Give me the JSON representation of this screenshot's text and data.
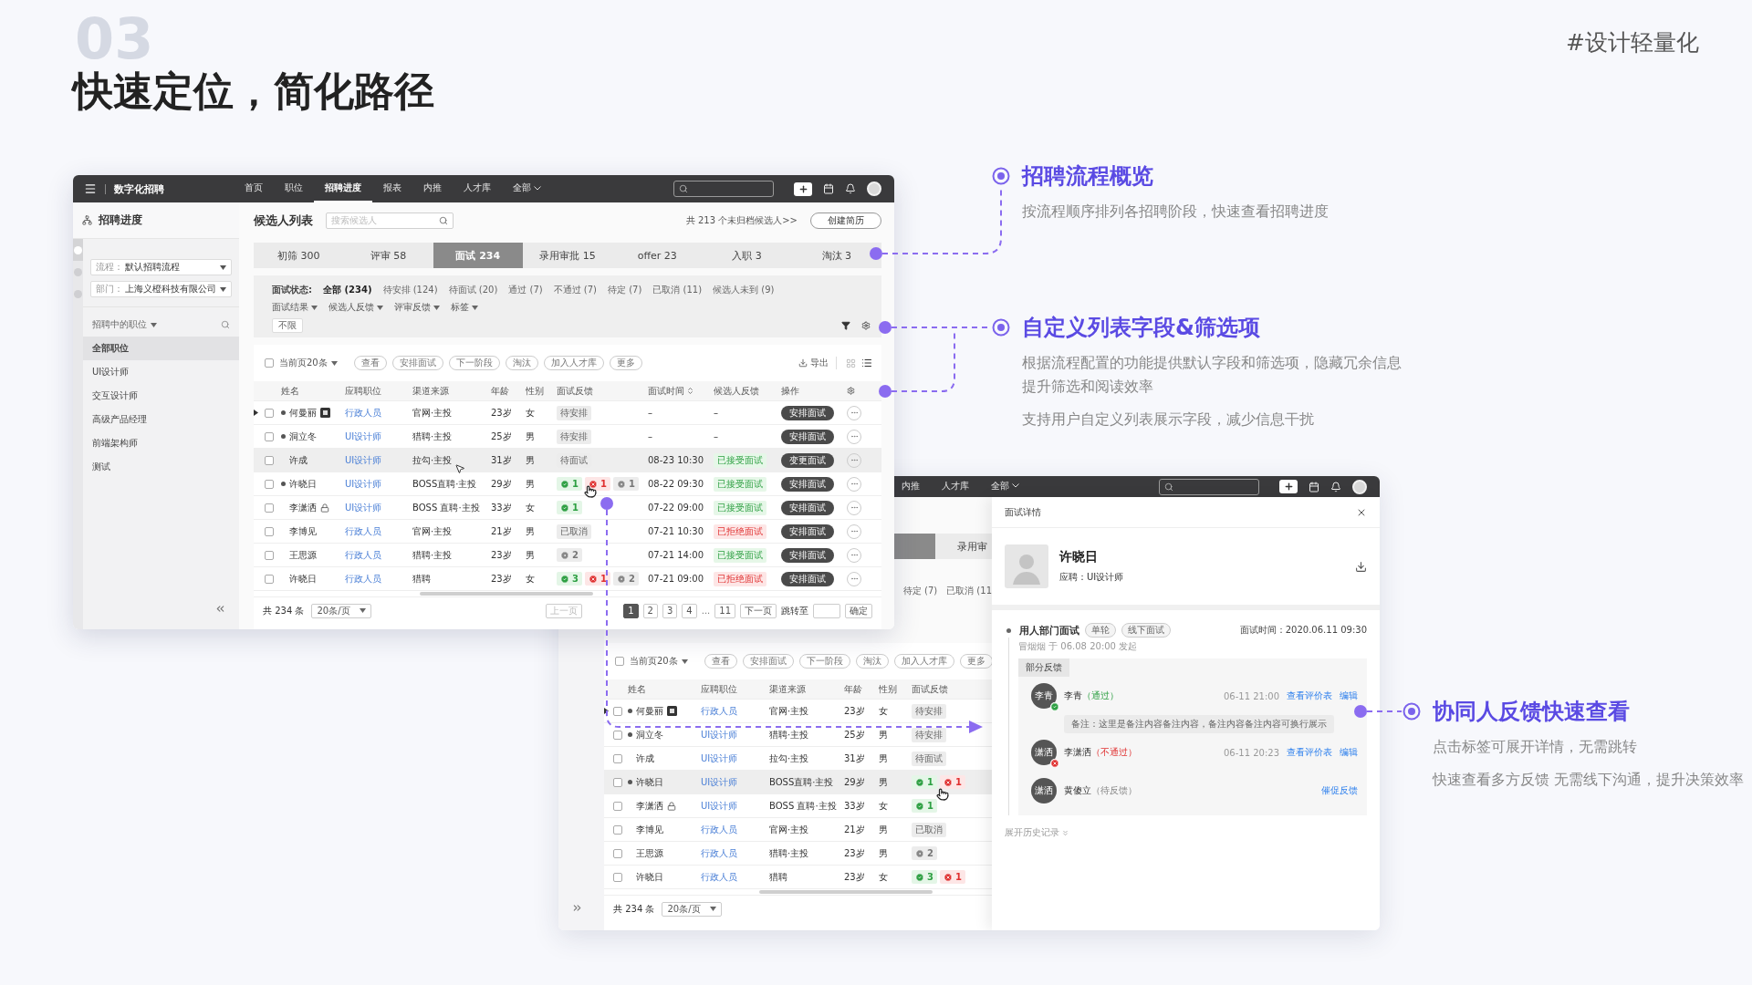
{
  "page": {
    "number": "03",
    "title": "快速定位，简化路径",
    "hashtag": "#设计轻量化"
  },
  "main_window": {
    "app_name": "数字化招聘",
    "nav": [
      {
        "label": "首页",
        "selected": false,
        "dropdown": false
      },
      {
        "label": "职位",
        "selected": false,
        "dropdown": false
      },
      {
        "label": "招聘进度",
        "selected": true,
        "dropdown": false
      },
      {
        "label": "报表",
        "selected": false,
        "dropdown": false
      },
      {
        "label": "内推",
        "selected": false,
        "dropdown": false
      },
      {
        "label": "人才库",
        "selected": false,
        "dropdown": false
      },
      {
        "label": "全部",
        "selected": false,
        "dropdown": true
      }
    ],
    "sidebar": {
      "title": "招聘进度",
      "rail": [
        {
          "selected": true
        },
        {
          "selected": false
        },
        {
          "selected": false
        }
      ],
      "selects": [
        {
          "label": "流程：",
          "value": "默认招聘流程"
        },
        {
          "label": "部门：",
          "value": "上海义橙科技有限公司"
        }
      ],
      "section": "招聘中的职位",
      "items": [
        {
          "label": "全部职位",
          "selected": true
        },
        {
          "label": "UI设计师",
          "selected": false
        },
        {
          "label": "交互设计师",
          "selected": false
        },
        {
          "label": "高级产品经理",
          "selected": false
        },
        {
          "label": "前端架构师",
          "selected": false
        },
        {
          "label": "测试",
          "selected": false
        }
      ]
    },
    "header": {
      "title": "候选人列表",
      "search_placeholder": "搜索候选人",
      "summary": "共 213 个未归档候选人>>",
      "create_button": "创建简历"
    },
    "stages": [
      {
        "label": "初筛",
        "count": "300",
        "selected": false
      },
      {
        "label": "评审",
        "count": "58",
        "selected": false
      },
      {
        "label": "面试",
        "count": "234",
        "selected": true
      },
      {
        "label": "录用审批",
        "count": "15",
        "selected": false
      },
      {
        "label": "offer",
        "count": "23",
        "selected": false
      },
      {
        "label": "入职",
        "count": "3",
        "selected": false
      },
      {
        "label": "淘汰",
        "count": "3",
        "selected": false
      }
    ],
    "filters": {
      "status_label": "面试状态:",
      "statuses": [
        {
          "label": "全部 (234)",
          "selected": true
        },
        {
          "label": "待安排 (124)",
          "selected": false
        },
        {
          "label": "待面试 (20)",
          "selected": false
        },
        {
          "label": "通过 (7)",
          "selected": false
        },
        {
          "label": "不通过 (7)",
          "selected": false
        },
        {
          "label": "待定 (7)",
          "selected": false
        },
        {
          "label": "已取消 (11)",
          "selected": false
        },
        {
          "label": "候选人未到 (9)",
          "selected": false
        }
      ],
      "dropdowns": [
        "面试结果",
        "候选人反馈",
        "评审反馈",
        "标签"
      ],
      "tag": "不限"
    },
    "toolbar": {
      "checked": false,
      "page_select": "当前页20条",
      "actions": [
        "查看",
        "安排面试",
        "下一阶段",
        "淘汰",
        "加入人才库",
        "更多"
      ],
      "export": "导出"
    },
    "columns": [
      {
        "label": "姓名",
        "sortable": false
      },
      {
        "label": "应聘职位",
        "sortable": false
      },
      {
        "label": "渠道来源",
        "sortable": false
      },
      {
        "label": "年龄",
        "sortable": false
      },
      {
        "label": "性别",
        "sortable": false
      },
      {
        "label": "面试反馈",
        "sortable": false
      },
      {
        "label": "面试时间",
        "sortable": true
      },
      {
        "label": "候选人反馈",
        "sortable": false
      },
      {
        "label": "操作",
        "sortable": false
      }
    ],
    "rows": [
      {
        "name": "何曼丽",
        "dot": true,
        "expandable": true,
        "flag": {
          "kind": "badge"
        },
        "checked": false,
        "highlighted": false,
        "position": "行政人员",
        "source": "官网·主投",
        "age": "23岁",
        "gender": "女",
        "feedback": {
          "kind": "tag",
          "text": "待安排"
        },
        "time": "–",
        "candidate": {
          "kind": "none",
          "text": "–"
        },
        "action": "安排面试"
      },
      {
        "name": "洞立冬",
        "dot": true,
        "expandable": false,
        "checked": false,
        "highlighted": false,
        "position": "UI设计师",
        "source": "猎聘·主投",
        "age": "25岁",
        "gender": "男",
        "feedback": {
          "kind": "tag",
          "text": "待安排"
        },
        "time": "–",
        "candidate": {
          "kind": "none",
          "text": "–"
        },
        "action": "安排面试"
      },
      {
        "name": "许成",
        "dot": false,
        "expandable": false,
        "checked": false,
        "highlighted": true,
        "position": "UI设计师",
        "source": "拉勾·主投",
        "age": "31岁",
        "gender": "男",
        "feedback": {
          "kind": "tag",
          "text": "待面试"
        },
        "time": "08-23 10:30",
        "candidate": {
          "kind": "accepted",
          "text": "已接受面试"
        },
        "action": "变更面试"
      },
      {
        "name": "许晓日",
        "dot": true,
        "expandable": false,
        "checked": false,
        "highlighted": false,
        "position": "UI设计师",
        "source": "BOSS直聘·主投",
        "age": "29岁",
        "gender": "男",
        "feedback": {
          "kind": "counts",
          "counts": [
            {
              "kind": "pass",
              "text": "1"
            },
            {
              "kind": "fail",
              "text": "1"
            },
            {
              "kind": "pending",
              "text": "1"
            }
          ]
        },
        "time": "08-22 09:30",
        "candidate": {
          "kind": "accepted",
          "text": "已接受面试"
        },
        "action": "安排面试"
      },
      {
        "name": "李潇洒",
        "dot": false,
        "expandable": false,
        "flag": {
          "kind": "lock"
        },
        "checked": false,
        "highlighted": false,
        "position": "UI设计师",
        "source": "BOSS 直聘·主投",
        "age": "33岁",
        "gender": "女",
        "feedback": {
          "kind": "counts",
          "counts": [
            {
              "kind": "pass",
              "text": "1"
            }
          ]
        },
        "time": "07-22 09:00",
        "candidate": {
          "kind": "accepted",
          "text": "已接受面试"
        },
        "action": "安排面试"
      },
      {
        "name": "李博见",
        "dot": false,
        "expandable": false,
        "checked": false,
        "highlighted": false,
        "position": "行政人员",
        "source": "官网·主投",
        "age": "21岁",
        "gender": "男",
        "feedback": {
          "kind": "tag",
          "text": "已取消"
        },
        "time": "07-21 10:30",
        "candidate": {
          "kind": "rejected",
          "text": "已拒绝面试"
        },
        "action": "安排面试"
      },
      {
        "name": "王思源",
        "dot": false,
        "expandable": false,
        "checked": false,
        "highlighted": false,
        "position": "行政人员",
        "source": "猎聘·主投",
        "age": "23岁",
        "gender": "男",
        "feedback": {
          "kind": "counts",
          "counts": [
            {
              "kind": "pending",
              "text": "2"
            }
          ]
        },
        "time": "07-21 14:00",
        "candidate": {
          "kind": "accepted",
          "text": "已接受面试"
        },
        "action": "安排面试"
      },
      {
        "name": "许晓日",
        "dot": false,
        "expandable": false,
        "checked": false,
        "highlighted": false,
        "position": "行政人员",
        "source": "猎聘",
        "age": "23岁",
        "gender": "女",
        "feedback": {
          "kind": "counts",
          "counts": [
            {
              "kind": "pass",
              "text": "3"
            },
            {
              "kind": "fail",
              "text": "1"
            },
            {
              "kind": "pending",
              "text": "2"
            }
          ]
        },
        "time": "07-21 09:00",
        "candidate": {
          "kind": "rejected",
          "text": "已拒绝面试"
        },
        "action": "安排面试"
      }
    ],
    "footer": {
      "total": "共 234 条",
      "page_size": "20条/页",
      "prev": "上一页",
      "pages": [
        {
          "label": "1",
          "selected": true,
          "kind": "page"
        },
        {
          "label": "2",
          "selected": false,
          "kind": "page"
        },
        {
          "label": "3",
          "selected": false,
          "kind": "page"
        },
        {
          "label": "4",
          "selected": false,
          "kind": "page"
        },
        {
          "label": "...",
          "selected": false,
          "kind": "ellipsis"
        },
        {
          "label": "11",
          "selected": false,
          "kind": "page"
        }
      ],
      "next": "下一页",
      "jump": "跳转至",
      "confirm": "确定"
    }
  },
  "detail_window": {
    "nav": [
      {
        "label": "内推",
        "selected": false,
        "dropdown": false
      },
      {
        "label": "人才库",
        "selected": false,
        "dropdown": false
      },
      {
        "label": "全部",
        "selected": false,
        "dropdown": true
      }
    ],
    "stage_tab": "录用审",
    "status_fragments": [
      "待定 (7)",
      "已取消 (11"
    ],
    "toolbar": {
      "checked": false,
      "page_select": "当前页20条",
      "actions": [
        "查看",
        "安排面试",
        "下一阶段",
        "淘汰",
        "加入人才库",
        "更多"
      ]
    },
    "columns": [
      {
        "label": "姓名",
        "sortable": false
      },
      {
        "label": "应聘职位",
        "sortable": false
      },
      {
        "label": "渠道来源",
        "sortable": false
      },
      {
        "label": "年龄",
        "sortable": false
      },
      {
        "label": "性别",
        "sortable": false
      },
      {
        "label": "面试反馈",
        "sortable": false
      }
    ],
    "rows": [
      {
        "name": "何曼丽",
        "dot": true,
        "expandable": true,
        "flag": {
          "kind": "badge"
        },
        "checked": false,
        "highlighted": false,
        "position": "行政人员",
        "source": "官网·主投",
        "age": "23岁",
        "gender": "女",
        "feedback": {
          "kind": "tag",
          "text": "待安排"
        }
      },
      {
        "name": "洞立冬",
        "dot": true,
        "expandable": false,
        "checked": false,
        "highlighted": false,
        "position": "UI设计师",
        "source": "猎聘·主投",
        "age": "25岁",
        "gender": "男",
        "feedback": {
          "kind": "tag",
          "text": "待安排"
        }
      },
      {
        "name": "许成",
        "dot": false,
        "expandable": false,
        "checked": false,
        "highlighted": false,
        "position": "UI设计师",
        "source": "拉勾·主投",
        "age": "31岁",
        "gender": "男",
        "feedback": {
          "kind": "tag",
          "text": "待面试"
        }
      },
      {
        "name": "许晓日",
        "dot": true,
        "expandable": false,
        "checked": false,
        "highlighted": true,
        "position": "UI设计师",
        "source": "BOSS直聘·主投",
        "age": "29岁",
        "gender": "男",
        "feedback": {
          "kind": "counts",
          "counts": [
            {
              "kind": "pass",
              "text": "1"
            },
            {
              "kind": "fail",
              "text": "1"
            }
          ]
        }
      },
      {
        "name": "李潇洒",
        "dot": false,
        "expandable": false,
        "flag": {
          "kind": "lock"
        },
        "checked": false,
        "highlighted": false,
        "position": "UI设计师",
        "source": "BOSS 直聘·主投",
        "age": "33岁",
        "gender": "女",
        "feedback": {
          "kind": "counts",
          "counts": [
            {
              "kind": "pass",
              "text": "1"
            }
          ]
        }
      },
      {
        "name": "李博见",
        "dot": false,
        "expandable": false,
        "checked": false,
        "highlighted": false,
        "position": "行政人员",
        "source": "官网·主投",
        "age": "21岁",
        "gender": "男",
        "feedback": {
          "kind": "tag",
          "text": "已取消"
        }
      },
      {
        "name": "王思源",
        "dot": false,
        "expandable": false,
        "checked": false,
        "highlighted": false,
        "position": "行政人员",
        "source": "猎聘·主投",
        "age": "23岁",
        "gender": "男",
        "feedback": {
          "kind": "counts",
          "counts": [
            {
              "kind": "pending",
              "text": "2"
            }
          ]
        }
      },
      {
        "name": "许晓日",
        "dot": false,
        "expandable": false,
        "checked": false,
        "highlighted": false,
        "position": "行政人员",
        "source": "猎聘",
        "age": "23岁",
        "gender": "女",
        "feedback": {
          "kind": "counts",
          "counts": [
            {
              "kind": "pass",
              "text": "3"
            },
            {
              "kind": "fail",
              "text": "1"
            }
          ]
        }
      }
    ],
    "footer": {
      "total": "共 234 条",
      "page_size": "20条/页"
    },
    "drawer": {
      "title": "面试详情",
      "name": "许晓日",
      "applied": "应聘：UI设计师",
      "round": {
        "title": "用人部门面试",
        "tags": [
          "单轮",
          "线下面试"
        ],
        "time": "面试时间：2020.06.11 09:30",
        "initiator": "冒烟烟 于 06.08 20:00 发起"
      },
      "feedback_tab": "部分反馈",
      "feedback": [
        {
          "avatar": "李青",
          "name": "李青",
          "kind": "pass",
          "result_text": "（通过）",
          "time": "06-11 21:00",
          "links": [
            "查看评价表",
            "编辑"
          ],
          "note": "备注：这里是备注内容备注内容，备注内容备注内容可换行展示"
        },
        {
          "avatar": "潇洒",
          "name": "李潇洒",
          "kind": "fail",
          "result_text": "（不通过）",
          "time": "06-11 20:23",
          "links": [
            "查看评价表",
            "编辑"
          ]
        },
        {
          "avatar": "潇洒",
          "name": "黄傻立",
          "kind": "pending",
          "result_text": "（待反馈）",
          "links": [
            "催促反馈"
          ]
        }
      ],
      "history": "展开历史记录"
    }
  },
  "annotations": [
    {
      "title": "招聘流程概览",
      "paragraphs": [
        [
          "按流程顺序排列各招聘阶段，快速查看招聘进度"
        ]
      ]
    },
    {
      "title": "自定义列表字段&筛选项",
      "paragraphs": [
        [
          "根据流程配置的功能提供默认字段和筛选项，隐藏冗余信息",
          "提升筛选和阅读效率"
        ],
        [
          "支持用户自定义列表展示字段，减少信息干扰"
        ]
      ]
    },
    {
      "title": "协同人反馈快速查看",
      "paragraphs": [
        [
          "点击标签可展开详情，无需跳转"
        ],
        [
          "快速查看多方反馈 无需线下沟通，提升决策效率"
        ]
      ]
    }
  ]
}
